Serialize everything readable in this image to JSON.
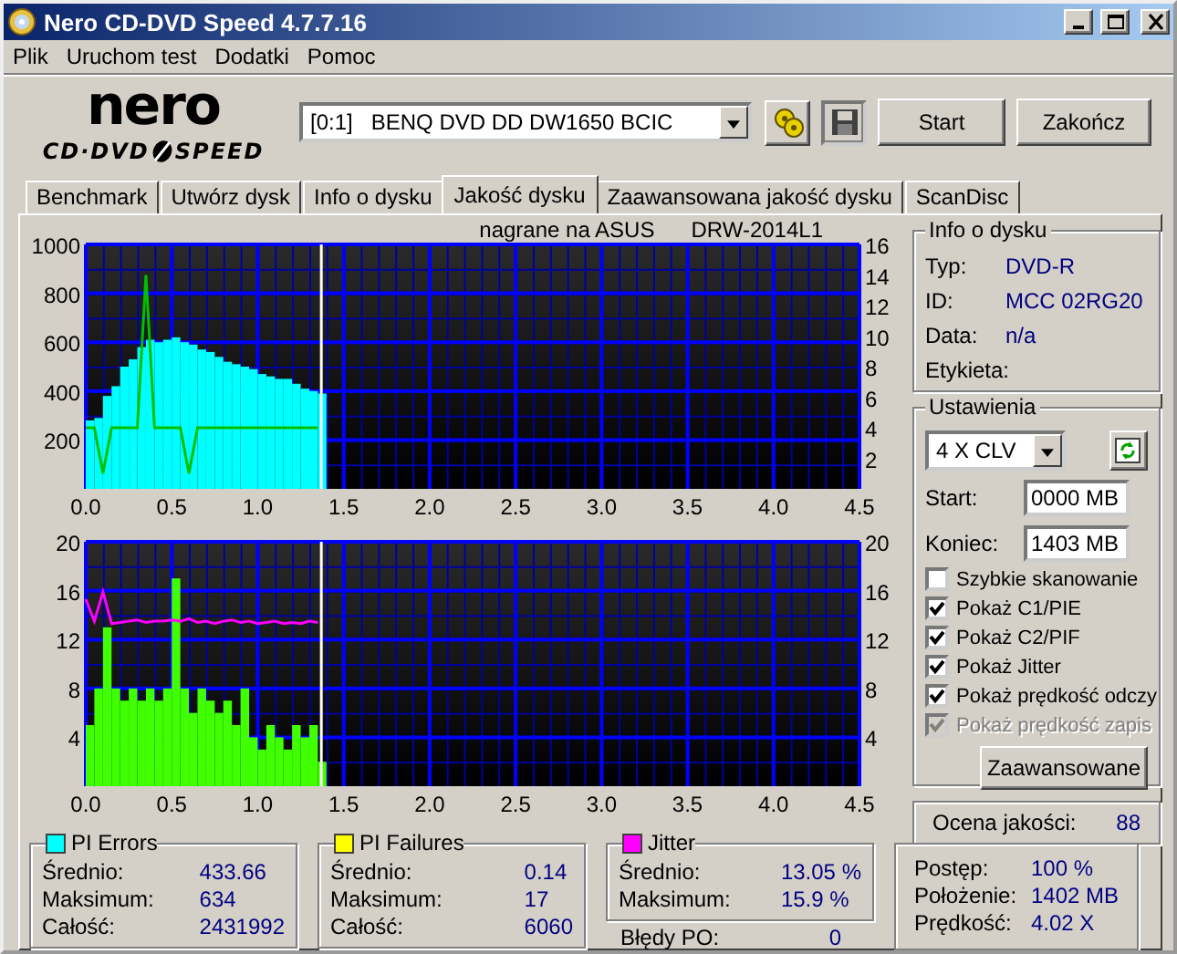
{
  "window": {
    "title": "Nero CD-DVD Speed 4.7.7.16"
  },
  "menu": [
    "Plik",
    "Uruchom test",
    "Dodatki",
    "Pomoc"
  ],
  "logo": {
    "brand": "nero",
    "line_left": "CD·DVD",
    "line_right": "SPEED"
  },
  "toolbar": {
    "drive": "[0:1]   BENQ DVD DD DW1650 BCIC",
    "start": "Start",
    "exit": "Zakończ"
  },
  "tabs": [
    {
      "label": "Benchmark",
      "selected": false
    },
    {
      "label": "Utwórz dysk",
      "selected": false
    },
    {
      "label": "Info o dysku",
      "selected": false
    },
    {
      "label": "Jakość dysku",
      "selected": true
    },
    {
      "label": "Zaawansowana jakość dysku",
      "selected": false
    },
    {
      "label": "ScanDisc",
      "selected": false
    }
  ],
  "charts": [
    {
      "chart_data": {
        "type": "bar",
        "title": "nagrane na ASUS      DRW-2014L1",
        "x": [
          0,
          0.05,
          0.1,
          0.15,
          0.2,
          0.25,
          0.3,
          0.35,
          0.4,
          0.45,
          0.5,
          0.55,
          0.6,
          0.65,
          0.7,
          0.75,
          0.8,
          0.85,
          0.9,
          0.95,
          1.0,
          1.05,
          1.1,
          1.15,
          1.2,
          1.25,
          1.3,
          1.35
        ],
        "xlim": [
          0,
          4.5
        ],
        "ylim": [
          0,
          1000
        ],
        "y2lim": [
          0,
          16
        ],
        "xticks": [
          {
            "value": 0,
            "label": "0.0"
          },
          {
            "value": 0.5,
            "label": "0.5"
          },
          {
            "value": 1,
            "label": "1.0"
          },
          {
            "value": 1.5,
            "label": "1.5"
          },
          {
            "value": 2,
            "label": "2.0"
          },
          {
            "value": 2.5,
            "label": "2.5"
          },
          {
            "value": 3,
            "label": "3.0"
          },
          {
            "value": 3.5,
            "label": "3.5"
          },
          {
            "value": 4,
            "label": "4.0"
          },
          {
            "value": 4.5,
            "label": "4.5"
          }
        ],
        "yticks": [
          200,
          400,
          600,
          800,
          1000
        ],
        "y2ticks": [
          2,
          4,
          6,
          8,
          10,
          12,
          14,
          16
        ],
        "series": [
          {
            "color": "#00ffff",
            "values": [
              280,
              290,
              380,
              420,
              500,
              530,
              580,
              610,
              600,
              610,
              620,
              600,
              590,
              570,
              560,
              540,
              520,
              510,
              500,
              490,
              470,
              460,
              450,
              450,
              430,
              410,
              400,
              390
            ]
          },
          {
            "type": "line",
            "axis": "y2",
            "color": "#00c000",
            "values": [
              4,
              4,
              1,
              4,
              4,
              4,
              4,
              14,
              4,
              4,
              4,
              4,
              1,
              4,
              4,
              4,
              4,
              4,
              4,
              4,
              4,
              4,
              4,
              4,
              4,
              4,
              4,
              4
            ]
          }
        ],
        "grid": true,
        "ref_lines": [
          {
            "axis": "x",
            "value": 1.37
          }
        ]
      }
    },
    {
      "chart_data": {
        "type": "bar",
        "x": [
          0,
          0.05,
          0.1,
          0.15,
          0.2,
          0.25,
          0.3,
          0.35,
          0.4,
          0.45,
          0.5,
          0.55,
          0.6,
          0.65,
          0.7,
          0.75,
          0.8,
          0.85,
          0.9,
          0.95,
          1.0,
          1.05,
          1.1,
          1.15,
          1.2,
          1.25,
          1.3,
          1.35
        ],
        "xlim": [
          0,
          4.5
        ],
        "ylim": [
          0,
          20
        ],
        "y2lim": [
          0,
          20
        ],
        "xticks": [
          {
            "value": 0,
            "label": "0.0"
          },
          {
            "value": 0.5,
            "label": "0.5"
          },
          {
            "value": 1,
            "label": "1.0"
          },
          {
            "value": 1.5,
            "label": "1.5"
          },
          {
            "value": 2,
            "label": "2.0"
          },
          {
            "value": 2.5,
            "label": "2.5"
          },
          {
            "value": 3,
            "label": "3.0"
          },
          {
            "value": 3.5,
            "label": "3.5"
          },
          {
            "value": 4,
            "label": "4.0"
          },
          {
            "value": 4.5,
            "label": "4.5"
          }
        ],
        "yticks": [
          4,
          8,
          12,
          16,
          20
        ],
        "y2ticks": [
          4,
          8,
          12,
          16,
          20
        ],
        "series": [
          {
            "color": "#40ff00",
            "values": [
              5,
              8,
              13,
              8,
              7,
              8,
              7,
              8,
              7,
              8,
              17,
              8,
              6,
              8,
              7,
              6,
              7,
              5,
              8,
              4,
              3,
              5,
              4,
              3,
              5,
              4,
              5,
              2
            ]
          },
          {
            "type": "line",
            "color": "#ff00ff",
            "values": [
              15.3,
              13.5,
              15.9,
              13.3,
              13.4,
              13.5,
              13.6,
              13.4,
              13.5,
              13.5,
              13.6,
              13.5,
              13.7,
              13.4,
              13.5,
              13.3,
              13.5,
              13.6,
              13.4,
              13.5,
              13.3,
              13.4,
              13.5,
              13.3,
              13.4,
              13.3,
              13.5,
              13.4
            ]
          }
        ],
        "grid": true,
        "ref_lines": [
          {
            "axis": "x",
            "value": 1.37
          }
        ]
      }
    }
  ],
  "disc_info": {
    "title": "Info o dysku",
    "fields": [
      {
        "label": "Typ:",
        "value": "DVD-R"
      },
      {
        "label": "ID:",
        "value": "MCC 02RG20"
      },
      {
        "label": "Data:",
        "value": "n/a"
      },
      {
        "label": "Etykieta:"
      }
    ]
  },
  "settings": {
    "title": "Ustawienia",
    "speed": "4 X CLV",
    "start_label": "Start:",
    "start": "0000 MB",
    "end_label": "Koniec:",
    "end": "1403 MB",
    "options": [
      {
        "label": "Szybkie skanowanie",
        "checked": false,
        "disabled": false
      },
      {
        "label": "Pokaż C1/PIE",
        "checked": true,
        "disabled": false
      },
      {
        "label": "Pokaż C2/PIF",
        "checked": true,
        "disabled": false
      },
      {
        "label": "Pokaż Jitter",
        "checked": true,
        "disabled": false
      },
      {
        "label": "Pokaż prędkość odczy",
        "checked": true,
        "disabled": false
      },
      {
        "label": "Pokaż prędkość zapis",
        "checked": true,
        "disabled": true
      }
    ],
    "button": "Zaawansowane"
  },
  "quality": {
    "label": "Ocena jakości:",
    "value": "88"
  },
  "stats": [
    {
      "title": "PI Errors",
      "color": "#00ffff",
      "rows": [
        {
          "label": "Średnio:",
          "value": "433.66"
        },
        {
          "label": "Maksimum:",
          "value": "634"
        },
        {
          "label": "Całość:",
          "value": "2431992"
        }
      ]
    },
    {
      "title": "PI Failures",
      "color": "#ffff00",
      "rows": [
        {
          "label": "Średnio:",
          "value": "0.14"
        },
        {
          "label": "Maksimum:",
          "value": "17"
        },
        {
          "label": "Całość:",
          "value": "6060"
        }
      ]
    },
    {
      "title": "Jitter",
      "color": "#ff00ff",
      "rows": [
        {
          "label": "Średnio:",
          "value": "13.05 %"
        },
        {
          "label": "Maksimum:",
          "value": "15.9 %"
        }
      ],
      "extra": {
        "label": "Błędy PO:",
        "value": "0"
      }
    }
  ],
  "progress": [
    {
      "label": "Postęp:",
      "value": "100 %"
    },
    {
      "label": "Położenie:",
      "value": "1402 MB"
    },
    {
      "label": "Prędkość:",
      "value": "4.02 X"
    }
  ]
}
